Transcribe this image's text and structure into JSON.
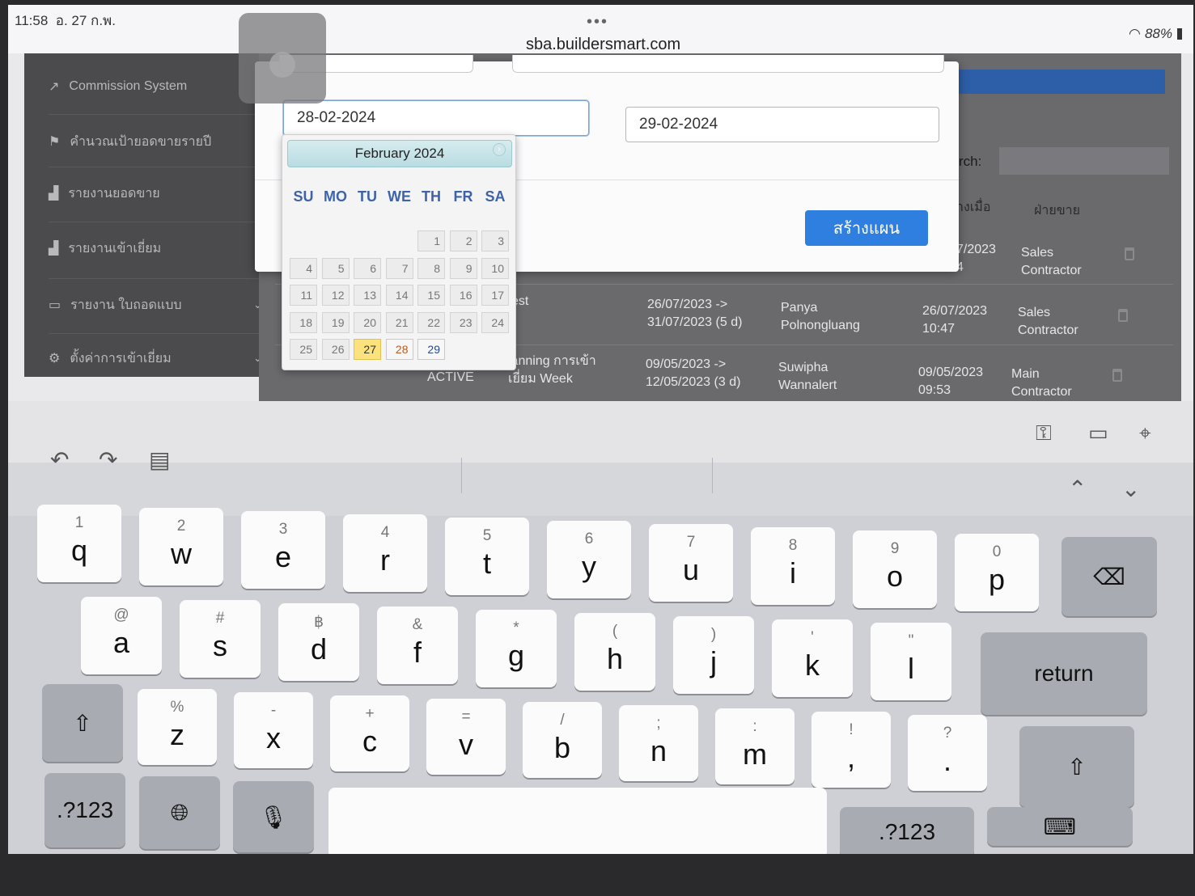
{
  "status_bar": {
    "time": "11:58",
    "date": "อ. 27 ก.พ.",
    "url": "sba.buildersmart.com",
    "battery": "88%"
  },
  "sidebar": {
    "items": [
      {
        "label": "Commission System",
        "icon": "external-link-icon"
      },
      {
        "label": "คำนวณเป้ายอดขายรายปี",
        "icon": "flag-icon"
      },
      {
        "label": "รายงานยอดขาย",
        "icon": "bar-chart-icon"
      },
      {
        "label": "รายงานเข้าเยี่ยม",
        "icon": "bar-chart-icon"
      },
      {
        "label": "รายงาน ใบถอดแบบ",
        "icon": "document-icon",
        "expandable": true
      },
      {
        "label": "ตั้งค่าการเข้าเยี่ยม",
        "icon": "gear-icon",
        "expandable": true
      }
    ]
  },
  "table": {
    "search_label": "rch:",
    "headers": {
      "created": "างเมื่อ",
      "department": "ฝ่ายขาย"
    },
    "rows": [
      {
        "status": "",
        "name": "",
        "period": "",
        "person": "",
        "created": "7/2023\n4",
        "department": "Sales\nContractor"
      },
      {
        "status": "",
        "name": "est",
        "period": "26/07/2023 ->\n31/07/2023 (5 d)",
        "person": "Panya\nPolnongluang",
        "created": "26/07/2023\n10:47",
        "department": "Sales\nContractor"
      },
      {
        "status": "ACTIVE",
        "name": "lanning การเข้า\nเยี่ยม Week",
        "period": "09/05/2023 ->\n12/05/2023 (3 d)",
        "person": "Suwipha\nWannalert",
        "created": "09/05/2023\n09:53",
        "department": "Main\nContractor"
      }
    ]
  },
  "modal": {
    "start_date": "28-02-2024",
    "end_date": "29-02-2024",
    "create_button": "สร้างแผน"
  },
  "datepicker": {
    "month_label": "February 2024",
    "weekdays": [
      "SU",
      "MO",
      "TU",
      "WE",
      "TH",
      "FR",
      "SA"
    ],
    "weeks": [
      [
        "",
        "",
        "",
        "",
        "1",
        "2",
        "3"
      ],
      [
        "4",
        "5",
        "6",
        "7",
        "8",
        "9",
        "10"
      ],
      [
        "11",
        "12",
        "13",
        "14",
        "15",
        "16",
        "17"
      ],
      [
        "18",
        "19",
        "20",
        "21",
        "22",
        "23",
        "24"
      ],
      [
        "25",
        "26",
        "27",
        "28",
        "29",
        "",
        ""
      ]
    ],
    "today": "27",
    "selectable": [
      "28",
      "29"
    ]
  },
  "keyboard": {
    "autofill_icons": [
      "key-icon",
      "credit-card-icon",
      "location-pin-icon"
    ],
    "row1": [
      {
        "hint": "1",
        "key": "q"
      },
      {
        "hint": "2",
        "key": "w"
      },
      {
        "hint": "3",
        "key": "e"
      },
      {
        "hint": "4",
        "key": "r"
      },
      {
        "hint": "5",
        "key": "t"
      },
      {
        "hint": "6",
        "key": "y"
      },
      {
        "hint": "7",
        "key": "u"
      },
      {
        "hint": "8",
        "key": "i"
      },
      {
        "hint": "9",
        "key": "o"
      },
      {
        "hint": "0",
        "key": "p"
      }
    ],
    "row2": [
      {
        "hint": "@",
        "key": "a"
      },
      {
        "hint": "#",
        "key": "s"
      },
      {
        "hint": "฿",
        "key": "d"
      },
      {
        "hint": "&",
        "key": "f"
      },
      {
        "hint": "*",
        "key": "g"
      },
      {
        "hint": "(",
        "key": "h"
      },
      {
        "hint": ")",
        "key": "j"
      },
      {
        "hint": "'",
        "key": "k"
      },
      {
        "hint": "\"",
        "key": "l"
      }
    ],
    "row3": [
      {
        "hint": "%",
        "key": "z"
      },
      {
        "hint": "-",
        "key": "x"
      },
      {
        "hint": "+",
        "key": "c"
      },
      {
        "hint": "=",
        "key": "v"
      },
      {
        "hint": "/",
        "key": "b"
      },
      {
        "hint": ";",
        "key": "n"
      },
      {
        "hint": ":",
        "key": "m"
      },
      {
        "hint": "!",
        "key": ","
      },
      {
        "hint": "?",
        "key": "."
      }
    ],
    "return_label": "return",
    "numbers_label": ".?123"
  }
}
